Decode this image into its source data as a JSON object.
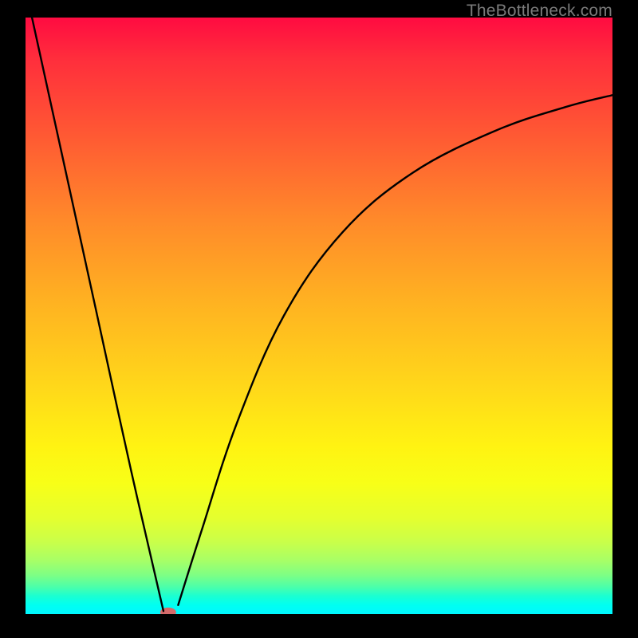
{
  "watermark": "TheBottleneck.com",
  "chart_data": {
    "type": "line",
    "title": "",
    "xlabel": "",
    "ylabel": "",
    "xlim": [
      0,
      100
    ],
    "ylim": [
      0,
      100
    ],
    "grid": false,
    "legend": false,
    "background_gradient": {
      "top": "#ff0b41",
      "bottom": "#00f7ff",
      "description": "red (top) → orange → yellow → green/cyan (bottom)"
    },
    "series": [
      {
        "name": "bottleneck-curve-left",
        "description": "steep descending line from top-left toward valley",
        "x": [
          1.1,
          6,
          12,
          18,
          23.5
        ],
        "y": [
          100,
          78,
          51,
          24,
          0.5
        ]
      },
      {
        "name": "bottleneck-curve-right",
        "description": "ascending concave curve from valley toward upper-right",
        "x": [
          26,
          30,
          36,
          44,
          54,
          66,
          80,
          92,
          100
        ],
        "y": [
          1.5,
          14,
          32,
          50,
          64,
          74,
          81,
          85,
          87
        ]
      }
    ],
    "marker": {
      "name": "valley-marker",
      "x": 24.3,
      "y": 0.3,
      "color": "#d46a6a",
      "shape": "ellipse"
    }
  }
}
